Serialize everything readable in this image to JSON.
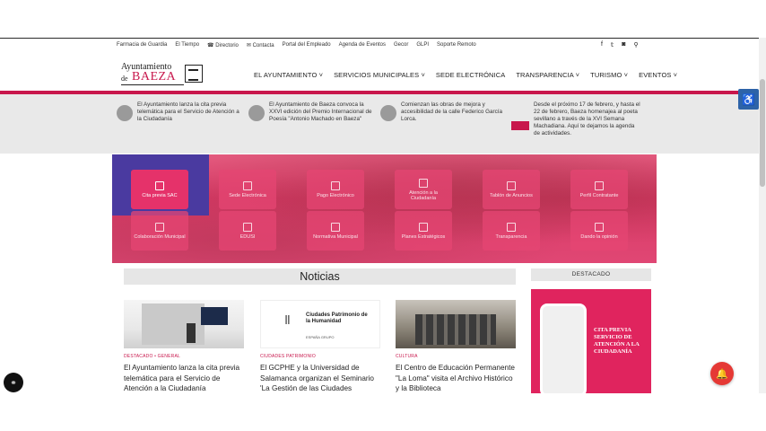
{
  "utility": {
    "links": [
      "Farmacia de Guardia",
      "El Tiempo",
      "Directorio",
      "Contacta",
      "Portal del Empleado",
      "Agenda de Eventos",
      "Gecor",
      "GLPI",
      "Soporte Remoto"
    ],
    "social_icons": [
      "facebook-icon",
      "twitter-icon",
      "instagram-icon",
      "search-icon"
    ]
  },
  "logo": {
    "top": "Ayuntamiento",
    "de": "de",
    "name": "BAEZA"
  },
  "nav": {
    "items": [
      "EL AYUNTAMIENTO ˅",
      "SERVICIOS MUNICIPALES ˅",
      "SEDE ELECTRÓNICA",
      "TRANSPARENCIA ˅",
      "TURISMO ˅",
      "EVENTOS ˅"
    ]
  },
  "ticker": [
    {
      "text": "El Ayuntamiento lanza la cita previa telemática para el Servicio de Atención a la Ciudadanía"
    },
    {
      "text": "El Ayuntamiento de Baeza convoca la XXVI edición del Premio Internacional de Poesía \"Antonio Machado en Baeza\""
    },
    {
      "text": "Comienzan las obras de mejora y accesibilidad de la calle Federico García Lorca."
    },
    {
      "text": "Desde el próximo 17 de febrero, y hasta el 22 de febrero, Baeza homenajea al poeta sevillano a través de la XVI Semana Machadiana. Aquí te dejamos la agenda de actividades."
    }
  ],
  "services": [
    {
      "label": "Cita previa SAC",
      "active": true
    },
    {
      "label": "Sede Electrónica",
      "active": false
    },
    {
      "label": "Pago Electrónico",
      "active": false
    },
    {
      "label": "Atención a la Ciudadanía",
      "active": false
    },
    {
      "label": "Tablón de Anuncios",
      "active": false
    },
    {
      "label": "Perfil Contratante",
      "active": false
    },
    {
      "label": "Colaboración Municipal",
      "active": false
    },
    {
      "label": "EDUSI",
      "active": false
    },
    {
      "label": "Normativa Municipal",
      "active": false
    },
    {
      "label": "Planes Estratégicos",
      "active": false
    },
    {
      "label": "Transparencia",
      "active": false
    },
    {
      "label": "Dando la opinión",
      "active": false
    }
  ],
  "noticias": {
    "title": "Noticias",
    "cards": [
      {
        "category": "DESTACADO • GENERAL",
        "title": "El Ayuntamiento lanza la cita previa telemática para el Servicio de Atención a la Ciudadanía"
      },
      {
        "category": "CIUDADES PATRIMONIO",
        "title": "El GCPHE y la Universidad de Salamanca organizan el Seminario 'La Gestión de las Ciudades",
        "img_text": "Ciudades Patrimonio de la Humanidad",
        "img_sub": "ESPAÑA GRUPO"
      },
      {
        "category": "CULTURA",
        "title": "El Centro de Educación Permanente \"La Loma\" visita el Archivo Histórico y la Biblioteca"
      }
    ]
  },
  "destacado": {
    "title": "DESTACADO",
    "banner_text": "CITA PREVIA SERVICIO DE ATENCIÓN A LA CIUDADANÍA"
  },
  "colors": {
    "brand": "#c8174c",
    "services_bg": "#d93a66",
    "highlight": "#4a3aa0",
    "accessibility": "#2d63a8"
  }
}
